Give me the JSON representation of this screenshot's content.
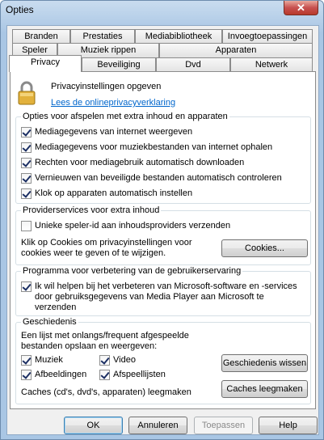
{
  "window": {
    "title": "Opties",
    "close_symbol": "✕"
  },
  "tabs": {
    "row1": [
      "Branden",
      "Prestaties",
      "Mediabibliotheek",
      "Invoegtoepassingen"
    ],
    "row2": [
      "Speler",
      "Muziek rippen",
      "Apparaten"
    ],
    "row3": [
      "Privacy",
      "Beveiliging",
      "Dvd",
      "Netwerk"
    ],
    "active": "Privacy"
  },
  "privacy": {
    "heading": "Privacyinstellingen opgeven",
    "link": "Lees de onlineprivacyverklaring"
  },
  "enhanced_playback": {
    "legend": "Opties voor afspelen met extra inhoud en apparaten",
    "items": [
      {
        "label": "Mediagegevens van internet weergeven",
        "checked": true
      },
      {
        "label": "Mediagegevens voor muziekbestanden van internet ophalen",
        "checked": true
      },
      {
        "label": "Rechten voor mediagebruik automatisch downloaden",
        "checked": true
      },
      {
        "label": "Vernieuwen van beveiligde bestanden automatisch controleren",
        "checked": true
      },
      {
        "label": "Klok op apparaten automatisch instellen",
        "checked": true
      }
    ]
  },
  "provider_services": {
    "legend": "Providerservices voor extra inhoud",
    "unique_id_label": "Unieke speler-id aan inhoudsproviders verzenden",
    "unique_id_checked": false,
    "cookies_text": "Klik op Cookies om privacyinstellingen voor cookies weer te geven of te wijzigen.",
    "cookies_button": "Cookies..."
  },
  "ceip": {
    "legend": "Programma voor verbetering van de gebruikerservaring",
    "label": "Ik wil helpen bij het verbeteren van Microsoft-software en -services door gebruiksgegevens van Media Player aan Microsoft te verzenden",
    "checked": true
  },
  "history": {
    "legend": "Geschiedenis",
    "description": "Een lijst met onlangs/frequent afgespeelde bestanden opslaan en weergeven:",
    "music": {
      "label": "Muziek",
      "checked": true
    },
    "video": {
      "label": "Video",
      "checked": true
    },
    "pictures": {
      "label": "Afbeeldingen",
      "checked": true
    },
    "playlists": {
      "label": "Afspeellijsten",
      "checked": true
    },
    "clear_history_button": "Geschiedenis wissen",
    "clear_caches_text": "Caches (cd's, dvd's, apparaten) leegmaken",
    "clear_caches_button": "Caches leegmaken"
  },
  "footer": {
    "ok": "OK",
    "cancel": "Annuleren",
    "apply": "Toepassen",
    "help": "Help"
  }
}
